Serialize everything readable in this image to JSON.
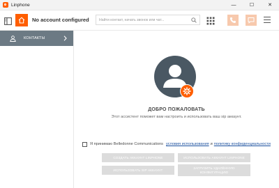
{
  "window": {
    "app_title": "Linphone",
    "min_glyph": "—",
    "max_glyph": "☐",
    "close_glyph": "✕"
  },
  "header": {
    "account_label": "No account configured",
    "search_placeholder": "Найти контакт, начать звонок или чат..."
  },
  "sidebar": {
    "items": [
      {
        "label": "КОНТАКТЫ",
        "icon": "contacts-icon"
      }
    ]
  },
  "welcome": {
    "title": "ДОБРО ПОЖАЛОВАТЬ",
    "subtitle": "Этот ассистент поможет вам настроить и использовать ваш sip аккаунт."
  },
  "terms": {
    "prefix": "Я принимаю Belledonne Communications",
    "terms_link": "условия использования",
    "and": "и",
    "privacy_link": "политику конфиденциальности",
    "checked": false
  },
  "actions": {
    "create_account": "СОЗДАТЬ АККАУНТ LINPHONE",
    "use_linphone_account": "ИСПОЛЬЗОВАТЬ АККАУНТ LINPHONE",
    "use_sip_account": "ИСПОЛЬЗОВАТЬ SIP АККАУНТ",
    "fetch_remote_config_line1": "ЗАГРУЗИТЬ УДАЛЁННУЮ",
    "fetch_remote_config_line2": "КОНФИГУРАЦИЮ"
  },
  "colors": {
    "accent": "#ff5e00",
    "accent_disabled": "#f7c9ad",
    "sidebar_selected": "#6c7a84",
    "avatar_bg": "#4a5863",
    "button_disabled": "#dcdcdc",
    "link": "#1a4f9e"
  }
}
